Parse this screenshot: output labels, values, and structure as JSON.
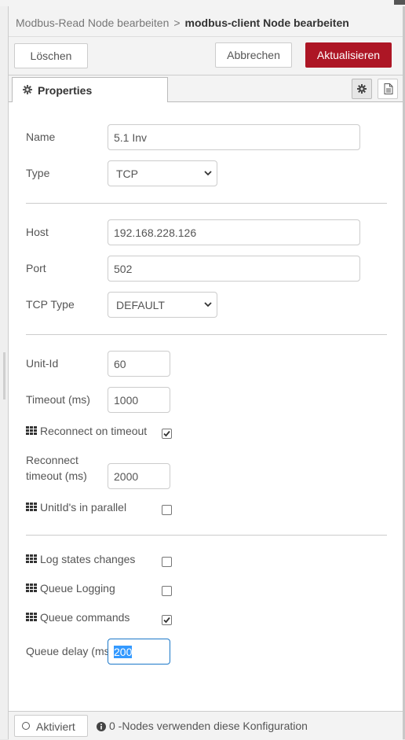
{
  "window": {
    "breadcrumb_parent": "Modbus-Read Node bearbeiten",
    "breadcrumb_separator": ">",
    "breadcrumb_current": "modbus-client Node bearbeiten"
  },
  "toolbar": {
    "delete_label": "Löschen",
    "cancel_label": "Abbrechen",
    "update_label": "Aktualisieren"
  },
  "tabs": {
    "properties_label": "Properties"
  },
  "form": {
    "name_label": "Name",
    "name_value": "5.1 Inv",
    "type_label": "Type",
    "type_value": "TCP",
    "host_label": "Host",
    "host_value": "192.168.228.126",
    "port_label": "Port",
    "port_value": "502",
    "tcp_type_label": "TCP Type",
    "tcp_type_value": "DEFAULT",
    "unit_id_label": "Unit-Id",
    "unit_id_value": "60",
    "timeout_label": "Timeout (ms)",
    "timeout_value": "1000",
    "reconnect_on_timeout_label": "Reconnect on timeout",
    "reconnect_on_timeout_checked": true,
    "reconnect_timeout_label_line1": "Reconnect",
    "reconnect_timeout_label_line2": "timeout (ms)",
    "reconnect_timeout_value": "2000",
    "unitids_parallel_label": "UnitId's in parallel",
    "unitids_parallel_checked": false,
    "log_states_label": "Log states changes",
    "log_states_checked": false,
    "queue_logging_label": "Queue Logging",
    "queue_logging_checked": false,
    "queue_commands_label": "Queue commands",
    "queue_commands_checked": true,
    "queue_delay_label": "Queue delay (ms)",
    "queue_delay_value": "200"
  },
  "footer": {
    "toggle_label": "Aktiviert",
    "info_text": "0 -Nodes verwenden diese Konfiguration"
  },
  "colors": {
    "primary_button": "#ad1625",
    "focus_border": "#1b78c9"
  }
}
